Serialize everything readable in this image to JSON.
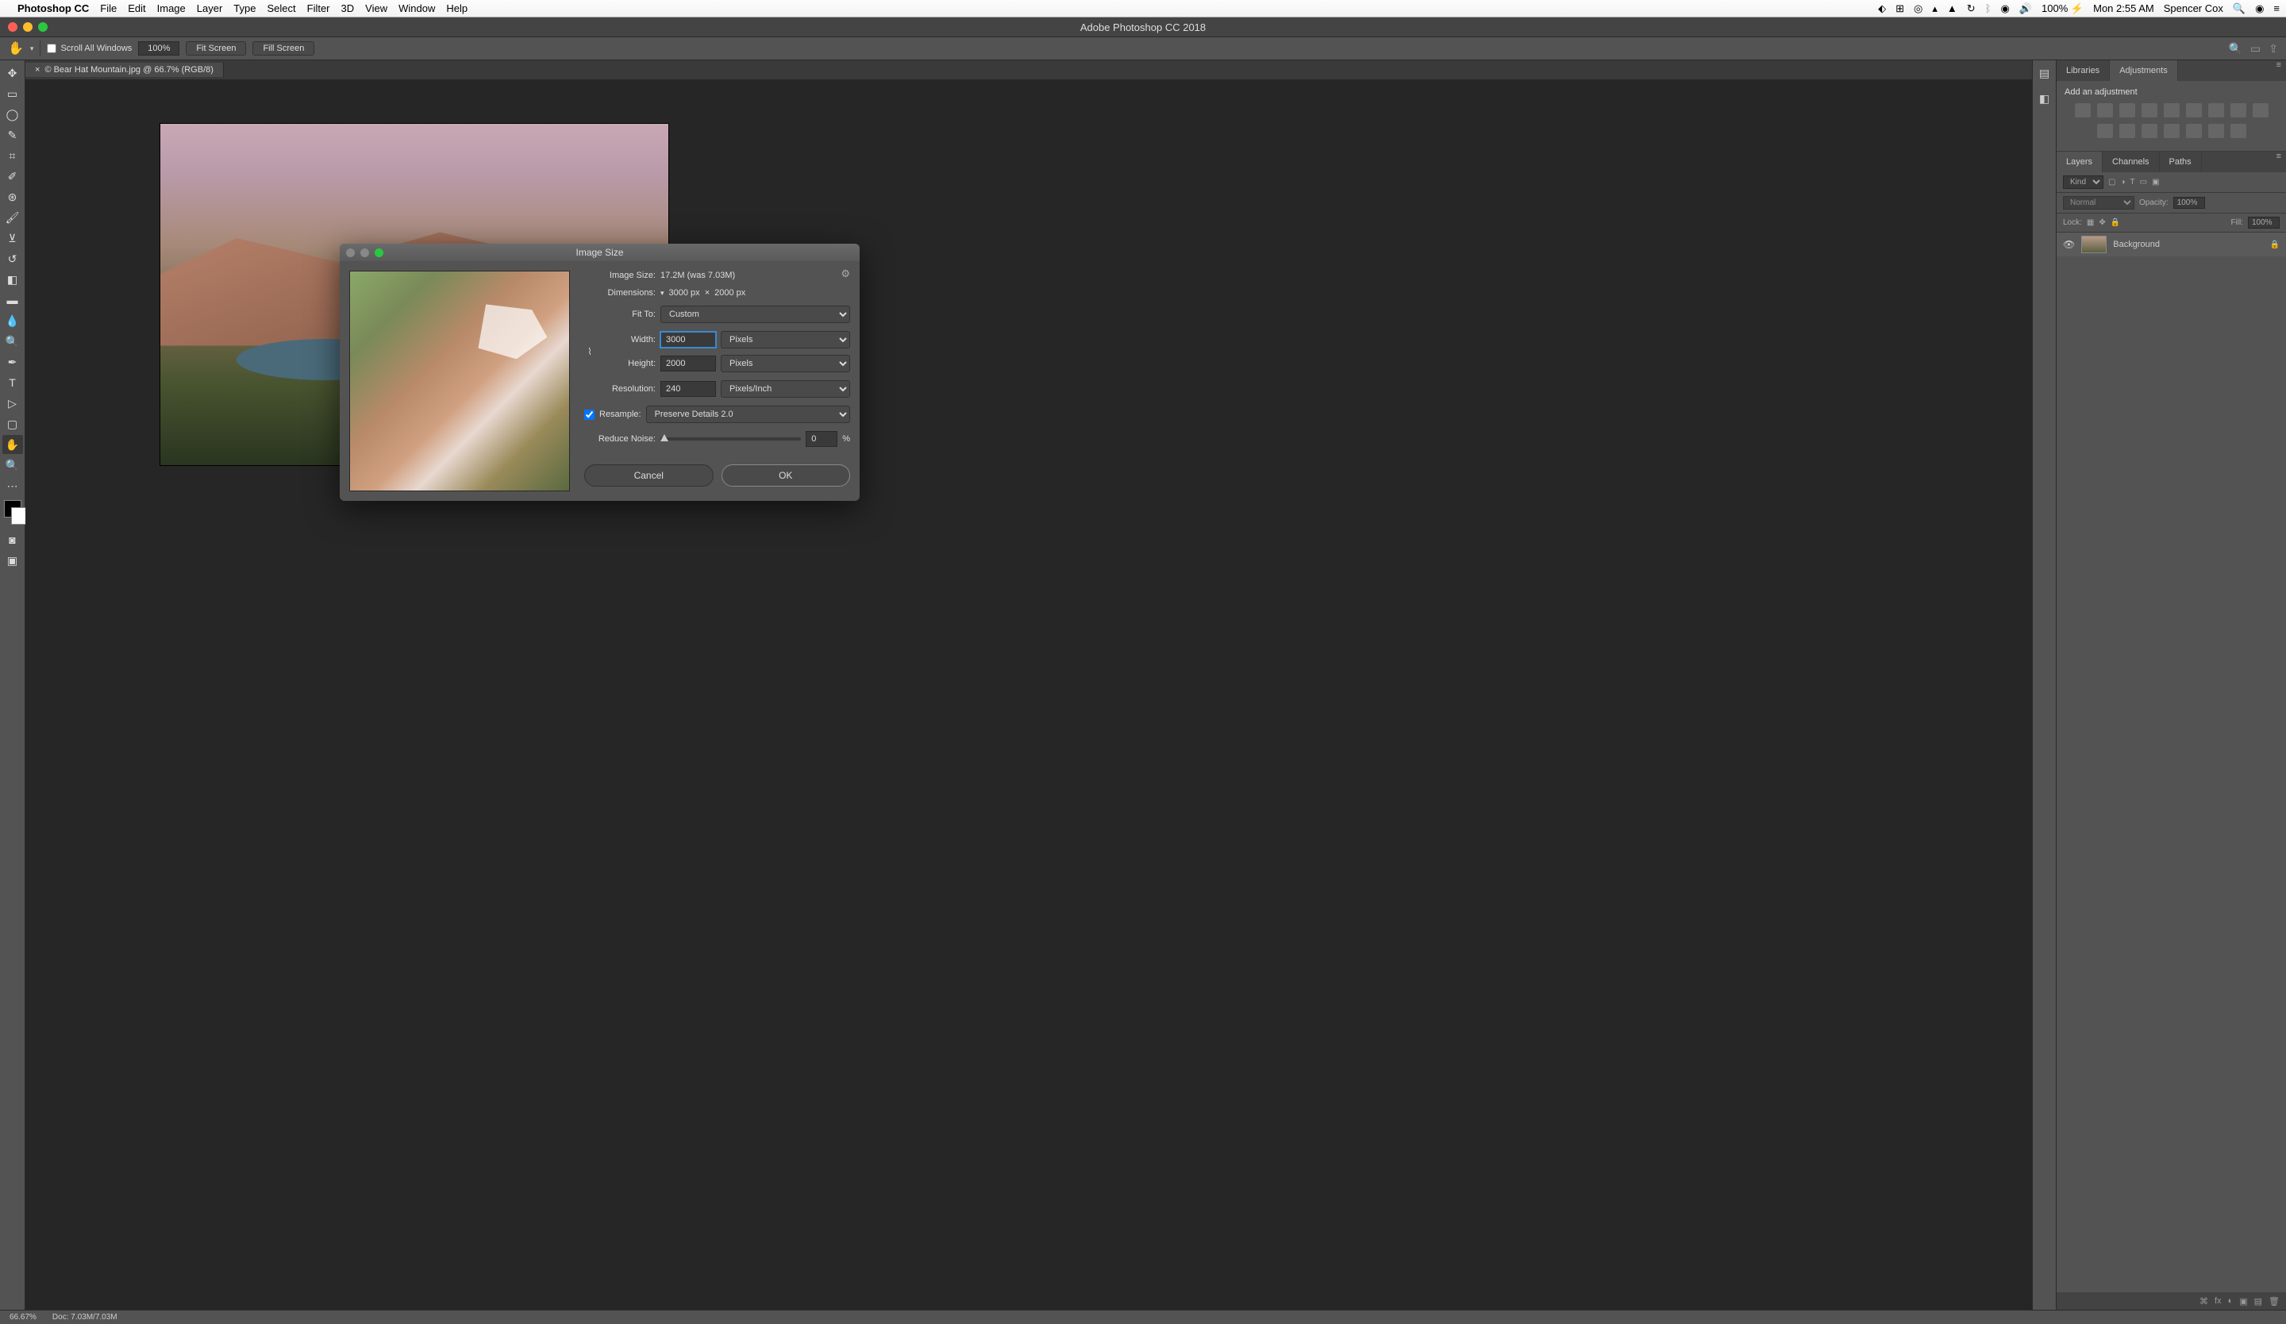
{
  "menubar": {
    "app": "Photoshop CC",
    "items": [
      "File",
      "Edit",
      "Image",
      "Layer",
      "Type",
      "Select",
      "Filter",
      "3D",
      "View",
      "Window",
      "Help"
    ],
    "battery": "100%",
    "clock": "Mon 2:55 AM",
    "user": "Spencer Cox"
  },
  "window": {
    "title": "Adobe Photoshop CC 2018"
  },
  "options": {
    "scroll_all": "Scroll All Windows",
    "zoom": "100%",
    "fit": "Fit Screen",
    "fill": "Fill Screen"
  },
  "document": {
    "tab": "© Bear Hat Mountain.jpg @ 66.7% (RGB/8)"
  },
  "panels": {
    "libraries": "Libraries",
    "adjustments": "Adjustments",
    "add_adj": "Add an adjustment",
    "layers": "Layers",
    "channels": "Channels",
    "paths": "Paths",
    "kind": "Kind",
    "blend": "Normal",
    "opacity_lbl": "Opacity:",
    "opacity_val": "100%",
    "lock_lbl": "Lock:",
    "fill_lbl": "Fill:",
    "fill_val": "100%",
    "layer_name": "Background"
  },
  "dialog": {
    "title": "Image Size",
    "image_size_lbl": "Image Size:",
    "image_size_val": "17.2M (was 7.03M)",
    "dimensions_lbl": "Dimensions:",
    "dim_w": "3000 px",
    "dim_x": "×",
    "dim_h": "2000 px",
    "fit_to_lbl": "Fit To:",
    "fit_to_val": "Custom",
    "width_lbl": "Width:",
    "width_val": "3000",
    "height_lbl": "Height:",
    "height_val": "2000",
    "wh_unit": "Pixels",
    "res_lbl": "Resolution:",
    "res_val": "240",
    "res_unit": "Pixels/Inch",
    "resample_lbl": "Resample:",
    "resample_val": "Preserve Details 2.0",
    "noise_lbl": "Reduce Noise:",
    "noise_val": "0",
    "noise_pct": "%",
    "cancel": "Cancel",
    "ok": "OK"
  },
  "status": {
    "zoom": "66.67%",
    "doc": "Doc: 7.03M/7.03M"
  }
}
